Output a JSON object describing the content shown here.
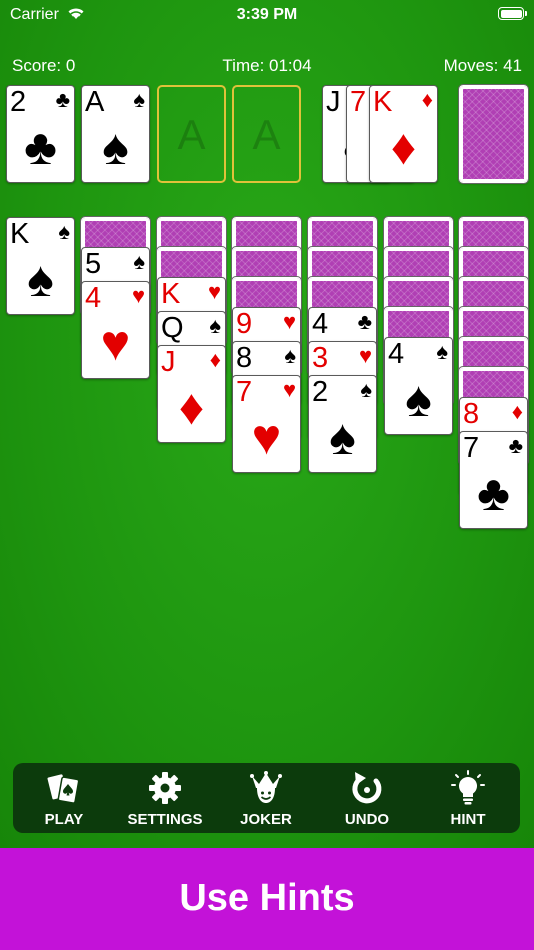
{
  "status": {
    "carrier": "Carrier",
    "time": "3:39 PM"
  },
  "hud": {
    "score": "Score: 0",
    "time": "Time: 01:04",
    "moves": "Moves: 41"
  },
  "foundations": [
    {
      "rank": "2",
      "suit": "♣"
    },
    {
      "rank": "A",
      "suit": "♠"
    },
    {
      "empty": "A"
    },
    {
      "empty": "A"
    }
  ],
  "waste": [
    {
      "rank": "J",
      "suit": "♠"
    },
    {
      "rank": "7",
      "suit": "♦"
    },
    {
      "rank": "K",
      "suit": "♦"
    }
  ],
  "tableau": [
    {
      "facedown": 0,
      "up": [
        {
          "rank": "K",
          "suit": "♠"
        }
      ]
    },
    {
      "facedown": 1,
      "up": [
        {
          "rank": "5",
          "suit": "♠"
        },
        {
          "rank": "4",
          "suit": "♥"
        }
      ]
    },
    {
      "facedown": 2,
      "up": [
        {
          "rank": "K",
          "suit": "♥"
        },
        {
          "rank": "Q",
          "suit": "♠"
        },
        {
          "rank": "J",
          "suit": "♦"
        }
      ]
    },
    {
      "facedown": 3,
      "up": [
        {
          "rank": "9",
          "suit": "♥"
        },
        {
          "rank": "8",
          "suit": "♠"
        },
        {
          "rank": "7",
          "suit": "♥"
        }
      ]
    },
    {
      "facedown": 3,
      "up": [
        {
          "rank": "4",
          "suit": "♣"
        },
        {
          "rank": "3",
          "suit": "♥"
        },
        {
          "rank": "2",
          "suit": "♠"
        }
      ]
    },
    {
      "facedown": 4,
      "up": [
        {
          "rank": "4",
          "suit": "♠"
        }
      ]
    },
    {
      "facedown": 6,
      "up": [
        {
          "rank": "8",
          "suit": "♦"
        },
        {
          "rank": "7",
          "suit": "♣"
        }
      ]
    }
  ],
  "toolbar": {
    "play": "PLAY",
    "settings": "SETTINGS",
    "joker": "JOKER",
    "undo": "UNDO",
    "hint": "HINT"
  },
  "icons": [
    "cards-icon",
    "gear-icon",
    "jester-icon",
    "undo-icon",
    "lightbulb-icon"
  ],
  "banner": "Use Hints",
  "colors": {
    "felt": "#1f9a12",
    "card_back": "#b03fb4",
    "banner": "#c312d8",
    "toolbar": "#0c3b0c",
    "red_suit": "#e30000"
  }
}
